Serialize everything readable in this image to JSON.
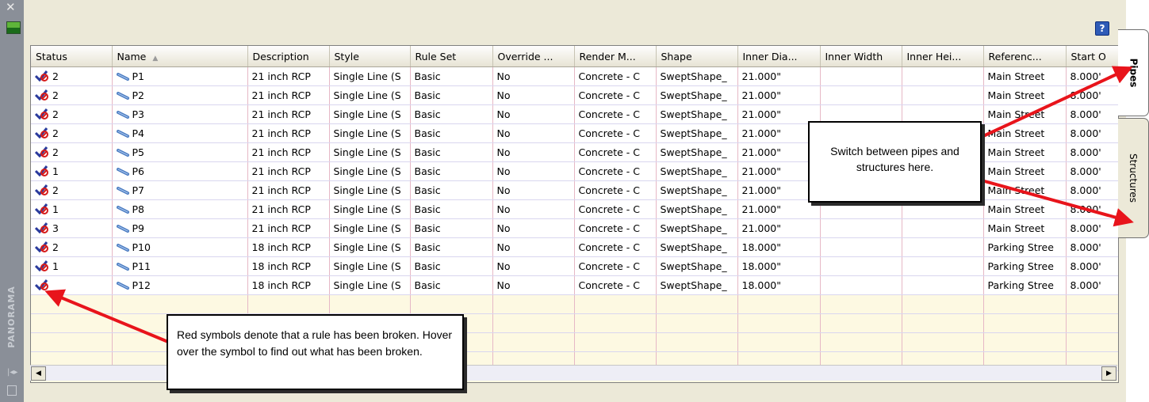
{
  "sidebar": {
    "close_glyph": "✕",
    "panorama_label": "PANORAMA"
  },
  "toolbar": {
    "help_glyph": "?"
  },
  "table": {
    "columns": [
      "Status",
      "Name",
      "Description",
      "Style",
      "Rule Set",
      "Override ...",
      "Render M...",
      "Shape",
      "Inner Dia...",
      "Inner Width",
      "Inner Hei...",
      "Referenc...",
      "Start O"
    ],
    "sorted_column": "Name",
    "rows": [
      {
        "status": "2",
        "name": "P1",
        "description": "21 inch RCP",
        "style": "Single Line (S",
        "rule_set": "Basic",
        "override": "No",
        "render": "Concrete - C",
        "shape": "SweptShape_",
        "inner_dia": "21.000\"",
        "inner_width": "",
        "inner_height": "",
        "reference": "Main Street",
        "start_offset": "8.000'"
      },
      {
        "status": "2",
        "name": "P2",
        "description": "21 inch RCP",
        "style": "Single Line (S",
        "rule_set": "Basic",
        "override": "No",
        "render": "Concrete - C",
        "shape": "SweptShape_",
        "inner_dia": "21.000\"",
        "inner_width": "",
        "inner_height": "",
        "reference": "Main Street",
        "start_offset": "8.000'"
      },
      {
        "status": "2",
        "name": "P3",
        "description": "21 inch RCP",
        "style": "Single Line (S",
        "rule_set": "Basic",
        "override": "No",
        "render": "Concrete - C",
        "shape": "SweptShape_",
        "inner_dia": "21.000\"",
        "inner_width": "",
        "inner_height": "",
        "reference": "Main Street",
        "start_offset": "8.000'"
      },
      {
        "status": "2",
        "name": "P4",
        "description": "21 inch RCP",
        "style": "Single Line (S",
        "rule_set": "Basic",
        "override": "No",
        "render": "Concrete - C",
        "shape": "SweptShape_",
        "inner_dia": "21.000\"",
        "inner_width": "",
        "inner_height": "",
        "reference": "Main Street",
        "start_offset": "8.000'"
      },
      {
        "status": "2",
        "name": "P5",
        "description": "21 inch RCP",
        "style": "Single Line (S",
        "rule_set": "Basic",
        "override": "No",
        "render": "Concrete - C",
        "shape": "SweptShape_",
        "inner_dia": "21.000\"",
        "inner_width": "",
        "inner_height": "",
        "reference": "Main Street",
        "start_offset": "8.000'"
      },
      {
        "status": "1",
        "name": "P6",
        "description": "21 inch RCP",
        "style": "Single Line (S",
        "rule_set": "Basic",
        "override": "No",
        "render": "Concrete - C",
        "shape": "SweptShape_",
        "inner_dia": "21.000\"",
        "inner_width": "",
        "inner_height": "",
        "reference": "Main Street",
        "start_offset": "8.000'"
      },
      {
        "status": "2",
        "name": "P7",
        "description": "21 inch RCP",
        "style": "Single Line (S",
        "rule_set": "Basic",
        "override": "No",
        "render": "Concrete - C",
        "shape": "SweptShape_",
        "inner_dia": "21.000\"",
        "inner_width": "",
        "inner_height": "",
        "reference": "Main Street",
        "start_offset": "8.000'"
      },
      {
        "status": "1",
        "name": "P8",
        "description": "21 inch RCP",
        "style": "Single Line (S",
        "rule_set": "Basic",
        "override": "No",
        "render": "Concrete - C",
        "shape": "SweptShape_",
        "inner_dia": "21.000\"",
        "inner_width": "",
        "inner_height": "",
        "reference": "Main Street",
        "start_offset": "8.000'"
      },
      {
        "status": "3",
        "name": "P9",
        "description": "21 inch RCP",
        "style": "Single Line (S",
        "rule_set": "Basic",
        "override": "No",
        "render": "Concrete - C",
        "shape": "SweptShape_",
        "inner_dia": "21.000\"",
        "inner_width": "",
        "inner_height": "",
        "reference": "Main Street",
        "start_offset": "8.000'"
      },
      {
        "status": "2",
        "name": "P10",
        "description": "18 inch RCP",
        "style": "Single Line (S",
        "rule_set": "Basic",
        "override": "No",
        "render": "Concrete - C",
        "shape": "SweptShape_",
        "inner_dia": "18.000\"",
        "inner_width": "",
        "inner_height": "",
        "reference": "Parking Stree",
        "start_offset": "8.000'"
      },
      {
        "status": "1",
        "name": "P11",
        "description": "18 inch RCP",
        "style": "Single Line (S",
        "rule_set": "Basic",
        "override": "No",
        "render": "Concrete - C",
        "shape": "SweptShape_",
        "inner_dia": "18.000\"",
        "inner_width": "",
        "inner_height": "",
        "reference": "Parking Stree",
        "start_offset": "8.000'"
      },
      {
        "status": "",
        "name": "P12",
        "description": "18 inch RCP",
        "style": "Single Line (S",
        "rule_set": "Basic",
        "override": "No",
        "render": "Concrete - C",
        "shape": "SweptShape_",
        "inner_dia": "18.000\"",
        "inner_width": "",
        "inner_height": "",
        "reference": "Parking Stree",
        "start_offset": "8.000'"
      }
    ],
    "empty_rows": 4
  },
  "tabs": [
    {
      "label": "Pipes",
      "active": true
    },
    {
      "label": "Structures",
      "active": false
    }
  ],
  "callouts": {
    "tabs_note": "Switch between pipes and structures here.",
    "rule_note": "Red symbols denote that a rule has been broken.  Hover over the symbol to find out what has been broken."
  },
  "colors": {
    "annotation_arrow": "#e8141b",
    "status_violation": "#d61a1a",
    "status_check": "#2a3a9c",
    "pipe_icon": "#4a7bc0"
  },
  "icons": {
    "status": "rule-violation-icon",
    "pipe": "pipe-icon",
    "sort": "sort-ascending-icon",
    "help": "help-icon",
    "scroll_left": "scroll-left-arrow-icon",
    "scroll_right": "scroll-right-arrow-icon"
  }
}
